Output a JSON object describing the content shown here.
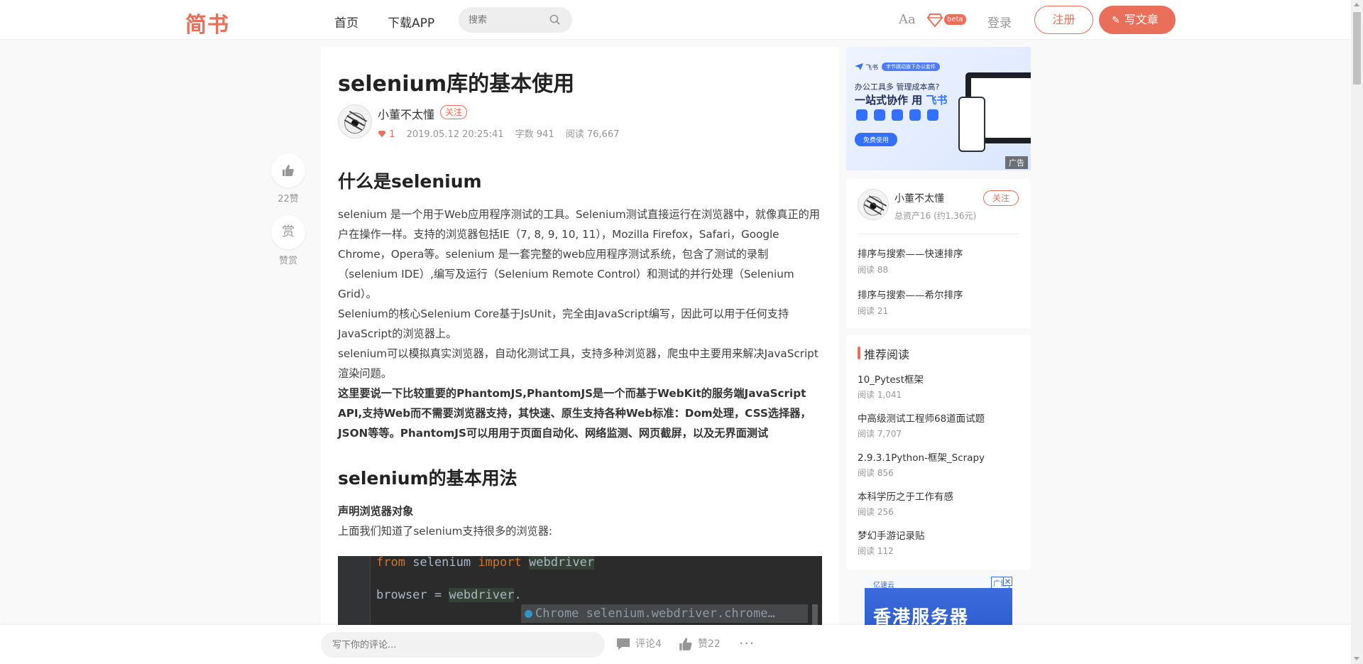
{
  "header": {
    "logo": "简书",
    "nav": [
      "首页",
      "下载APP"
    ],
    "search_placeholder": "搜索",
    "font_toggle": "Aa",
    "beta_badge": "beta",
    "login": "登录",
    "register": "注册",
    "write": "写文章"
  },
  "side": {
    "like_count": "22赞",
    "reward_icon": "赏",
    "reward_label": "赞赏"
  },
  "article": {
    "title": "selenium库的基本使用",
    "author": "小董不太懂",
    "follow": "关注",
    "gem_count": "1",
    "date": "2019.05.12 20:25:41",
    "words": "字数 941",
    "reads": "阅读 76,667",
    "h2_1": "什么是selenium",
    "p1": "selenium 是一个用于Web应用程序测试的工具。Selenium测试直接运行在浏览器中，就像真正的用户在操作一样。支持的浏览器包括IE（7, 8, 9, 10, 11），Mozilla Firefox，Safari，Google Chrome，Opera等。selenium 是一套完整的web应用程序测试系统，包含了测试的录制（selenium IDE）,编写及运行（Selenium Remote Control）和测试的并行处理（Selenium Grid）。",
    "p2": "Selenium的核心Selenium Core基于JsUnit，完全由JavaScript编写，因此可以用于任何支持JavaScript的浏览器上。",
    "p3": "selenium可以模拟真实浏览器，自动化测试工具，支持多种浏览器，爬虫中主要用来解决JavaScript渲染问题。",
    "p4": "这里要说一下比较重要的PhantomJS,PhantomJS是一个而基于WebKit的服务端JavaScript API,支持Web而不需要浏览器支持，其快速、原生支持各种Web标准：Dom处理，CSS选择器，JSON等等。PhantomJS可以用用于页面自动化、网络监测、网页截屏，以及无界面测试",
    "h2_2": "selenium的基本用法",
    "sub1": "声明浏览器对象",
    "p5": "上面我们知道了selenium支持很多的浏览器:",
    "code": {
      "line1_kw1": "from",
      "line1_mod": " selenium ",
      "line1_kw2": "import",
      "line1_name": "webdriver",
      "line2_var": "browser = ",
      "line2_obj": "webdriver",
      "line2_dot": ".",
      "completion": "Chrome selenium.webdriver.chrome…"
    }
  },
  "ad_top": {
    "brand": "飞书",
    "pill": "字节跳动旗下办公套件",
    "line1": "办公工具多 管理成本高?",
    "line2a": "一站式协作 用",
    "line2b": "飞书",
    "button": "免费使用",
    "tag": "广告"
  },
  "author_card": {
    "name": "小董不太懂",
    "asset": "总资产16 (约1.36元)",
    "follow": "关注",
    "posts": [
      {
        "title": "排序与搜索——快速排序",
        "reads": "阅读 88"
      },
      {
        "title": "排序与搜索——希尔排序",
        "reads": "阅读 21"
      }
    ]
  },
  "recommend": {
    "heading": "推荐阅读",
    "items": [
      {
        "title": "10_Pytest框架",
        "reads": "阅读 1,041"
      },
      {
        "title": "中高级测试工程师68道面试题",
        "reads": "阅读 7,707"
      },
      {
        "title": "2.9.3.1Python-框架_Scrapy",
        "reads": "阅读 856"
      },
      {
        "title": "本科学历之于工作有感",
        "reads": "阅读 256"
      },
      {
        "title": "梦幻手游记录贴",
        "reads": "阅读 112"
      }
    ]
  },
  "ad_bottom": {
    "brand": "亿速云",
    "text": "香港服务器",
    "tag": "广告",
    "close": "✕"
  },
  "bottom_bar": {
    "comment_placeholder": "写下你的评论...",
    "comments": "评论4",
    "likes": "赞22",
    "more": "···"
  },
  "colors": {
    "brand": "#ea6f5a",
    "background": "#f9f9f9",
    "code_bg": "#2b2b2b"
  }
}
